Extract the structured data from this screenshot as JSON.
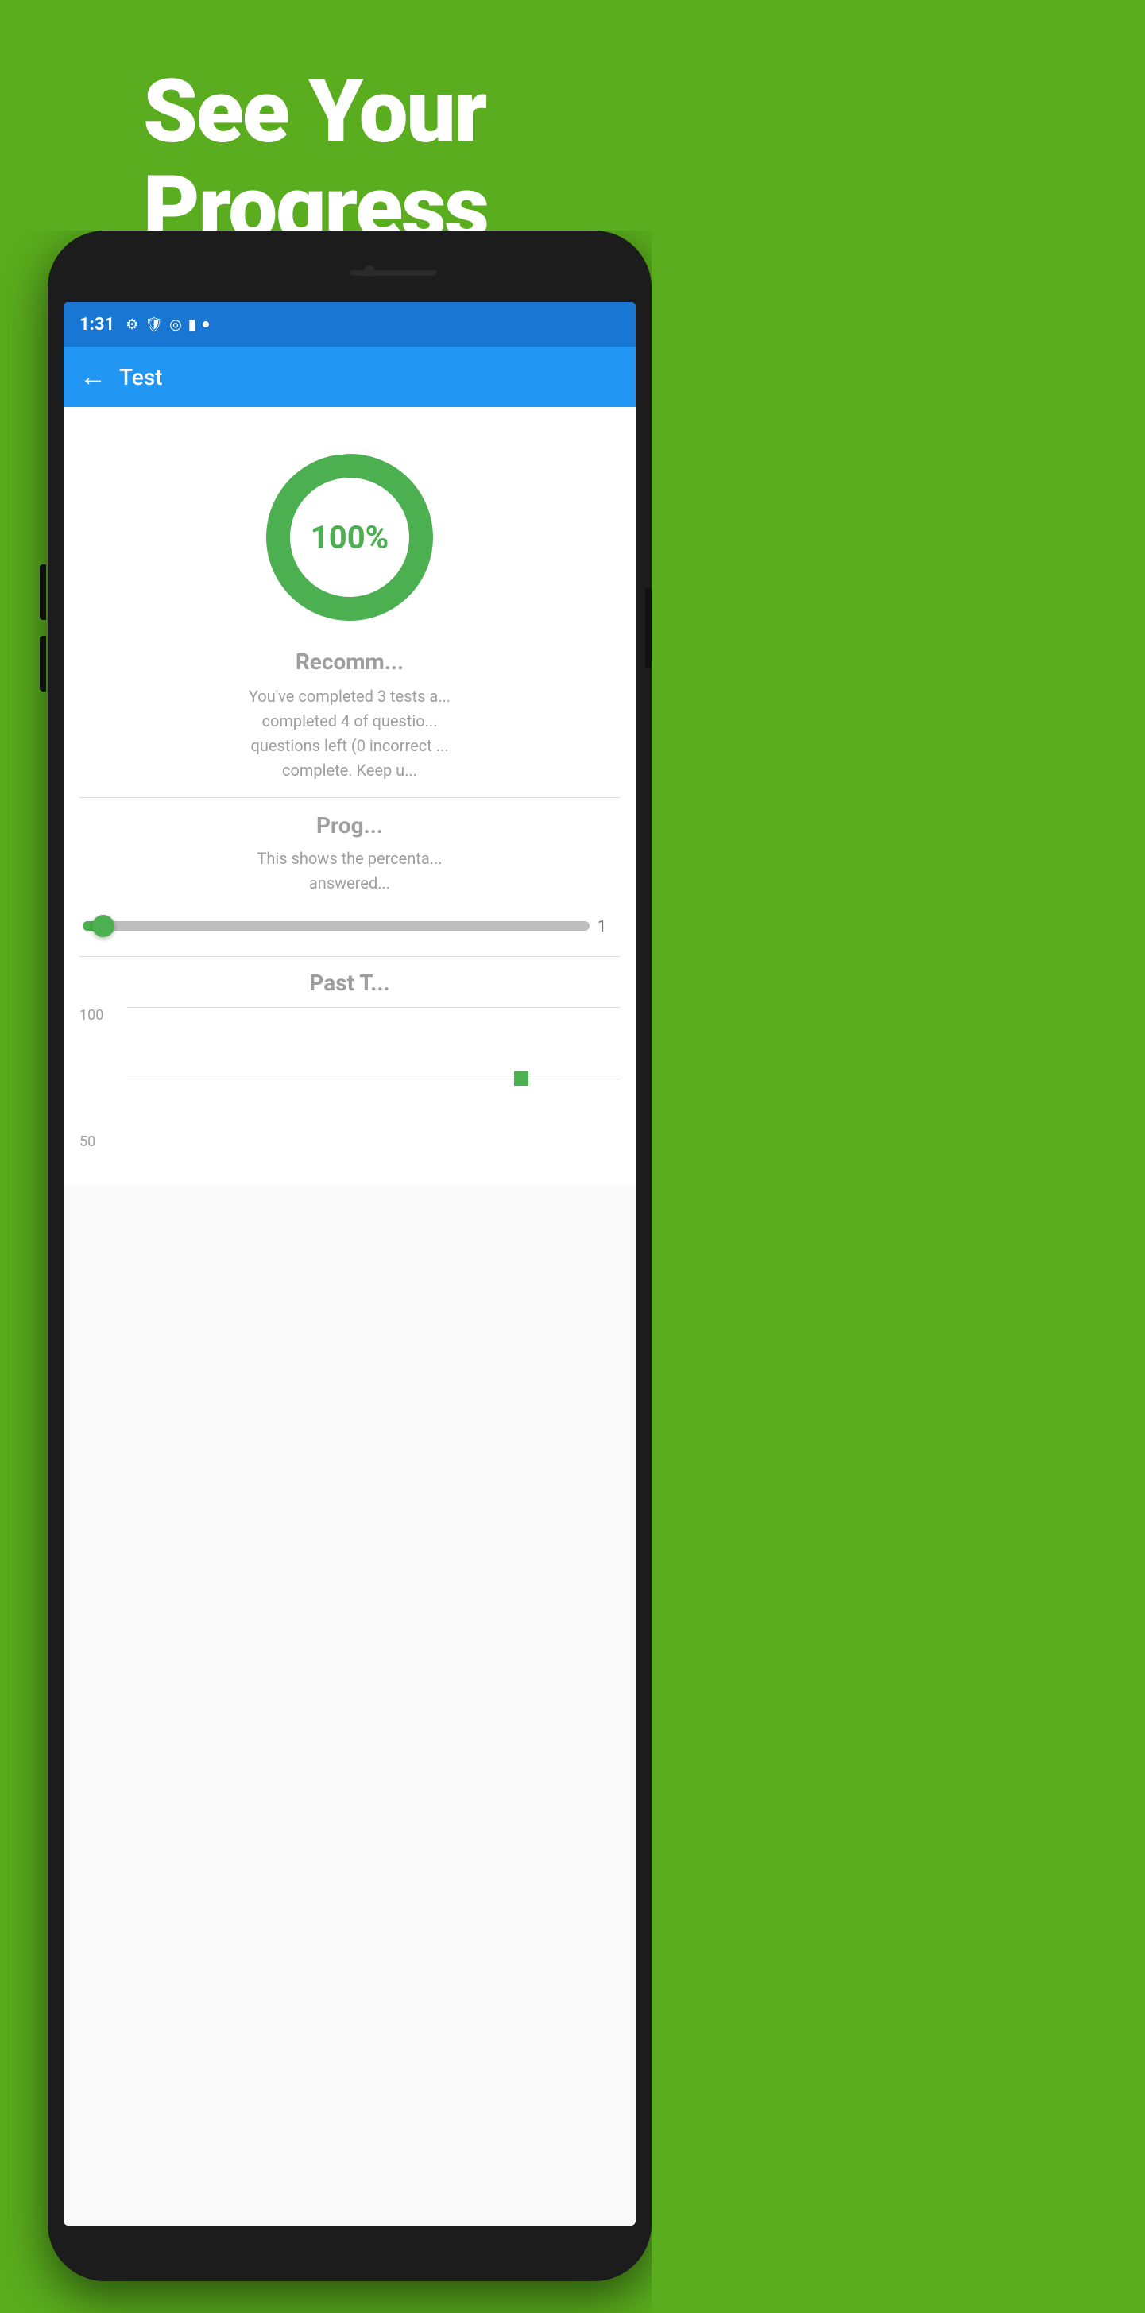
{
  "background_color": "#5aad1e",
  "hero": {
    "line1": "See Your",
    "line2": "Progress"
  },
  "phone": {
    "status_bar": {
      "time": "1:31",
      "background": "#1976d2"
    },
    "app_bar": {
      "title": "Test",
      "background": "#2196f3",
      "back_icon": "←"
    },
    "donut_chart": {
      "percentage": "100%",
      "color": "#4caf50",
      "bg_color": "#e8f5e9"
    },
    "recommendation": {
      "title": "Recomm...",
      "body": "You've completed 3 tests a... completed 4 of questio... questions left (0 incorrect ... complete. Keep u..."
    },
    "progress_section": {
      "title": "Prog...",
      "description": "This shows the percenta... answered...",
      "slider_value": "1",
      "slider_percent": 5
    },
    "past_tests": {
      "title": "Past T...",
      "y_labels": [
        "100",
        "50"
      ],
      "chart_dot_color": "#4caf50"
    }
  }
}
